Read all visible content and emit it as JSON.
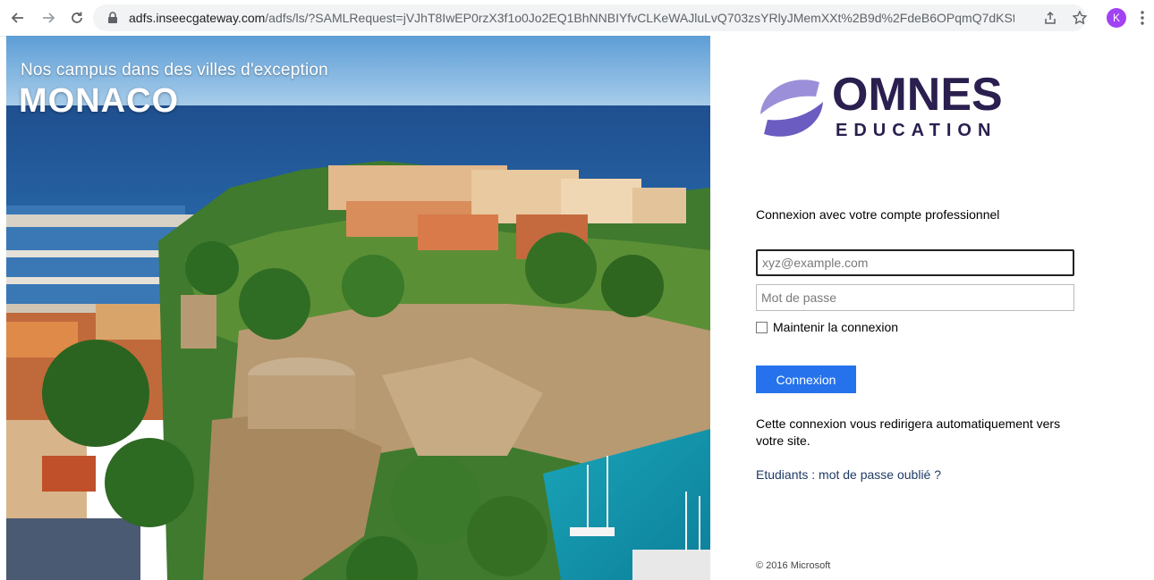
{
  "browser": {
    "url_host": "adfs.inseecgateway.com",
    "url_path": "/adfs/ls/?SAMLRequest=jVJhT8IwEP0rzX3f1o0Jo2EQ1BhNNBIYfvCLKeWAJluLvQ703zsYRlyJMemXXt%2B9d%2FdeB6OPqmQ7dKStySEO...",
    "avatar_letter": "K",
    "icons": [
      "back-arrow-icon",
      "forward-arrow-icon",
      "reload-icon",
      "lock-icon",
      "share-icon",
      "star-icon",
      "menu-kebab-icon"
    ]
  },
  "hero": {
    "subtitle": "Nos campus dans des villes d'exception",
    "city": "MONACO"
  },
  "logo": {
    "word": "OMNES",
    "sub": "EDUCATION",
    "color": "#2b1f4f",
    "accent": "#7b6cc4"
  },
  "login": {
    "heading": "Connexion avec votre compte professionnel",
    "email_placeholder": "xyz@example.com",
    "password_placeholder": "Mot de passe",
    "keep_signed_in": "Maintenir la connexion",
    "submit": "Connexion",
    "info": "Cette connexion vous redirigera automatiquement vers votre site.",
    "forgot": "Etudiants : mot de passe oublié ?",
    "footer": "© 2016 Microsoft",
    "button_color": "#2672ec"
  }
}
